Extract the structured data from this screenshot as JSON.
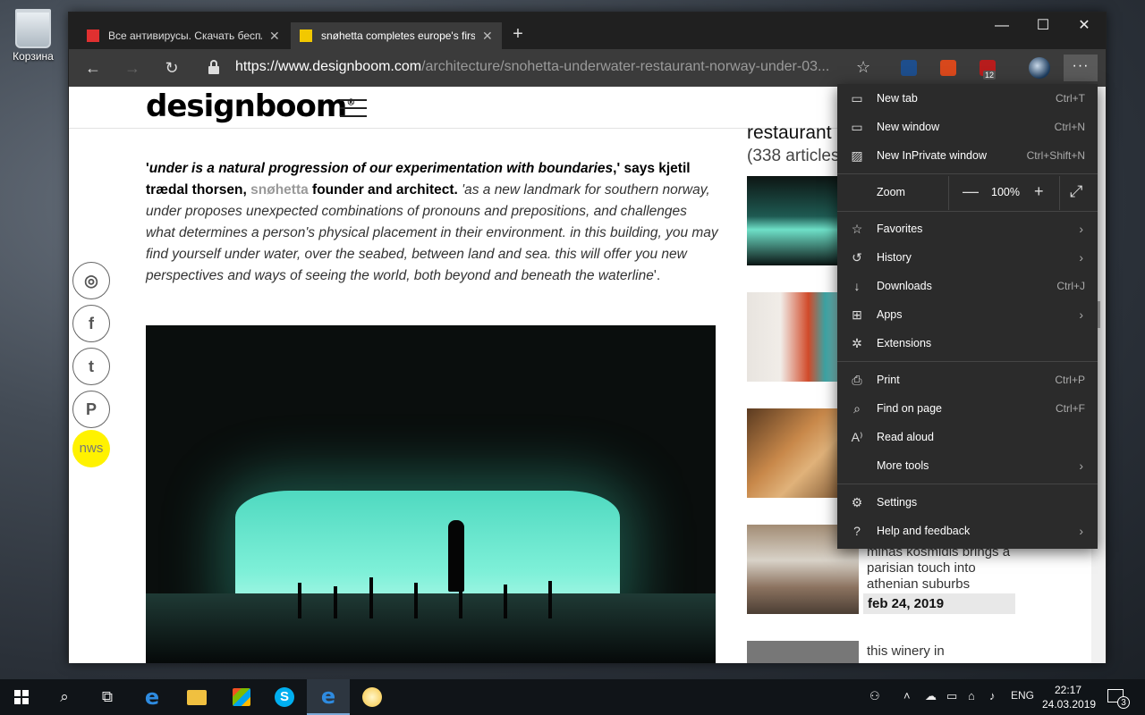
{
  "desktop": {
    "recycle_bin_label": "Корзина"
  },
  "browser": {
    "tabs": [
      {
        "title": "Все антивирусы. Скачать бесплатные"
      },
      {
        "title": "snøhetta completes europe's first"
      }
    ],
    "address": {
      "domain": "https://www.designboom.com",
      "path": "/architecture/snohetta-underwater-restaurant-norway-under-03..."
    },
    "extension_badge": "12",
    "more_button_label": "···"
  },
  "page": {
    "logo": "designboom",
    "logo_mark": "®",
    "quote": {
      "open": "'",
      "italic_bold": "under is a natural progression of our experimentation with boundaries",
      "after": ",' says kjetil trædal thorsen, ",
      "brand": "snøhetta",
      "role": " founder and architect. ",
      "body": "'as a new landmark for southern norway, under proposes unexpected combinations of pronouns and prepositions, and challenges what determines a person's physical placement in their environment. in this building, you may find yourself under water, over the seabed, between land and sea. this will offer you new perspectives and ways of seeing the world, both beyond and beneath the waterline",
      "close": "'."
    },
    "social": [
      "instagram-icon",
      "facebook-icon",
      "twitter-icon",
      "pinterest-icon"
    ],
    "nws_label": "nws",
    "sidebar": {
      "title": "restaurant",
      "count": "(338 articles",
      "cards": [
        {
          "text": "minas kosmidis brings a parisian touch into athenian suburbs",
          "date": "feb 24, 2019"
        },
        {
          "text": "this winery in"
        }
      ]
    }
  },
  "menu": {
    "items_top": [
      {
        "label": "New tab",
        "shortcut": "Ctrl+T",
        "icon": "new-tab-icon"
      },
      {
        "label": "New window",
        "shortcut": "Ctrl+N",
        "icon": "new-window-icon"
      },
      {
        "label": "New InPrivate window",
        "shortcut": "Ctrl+Shift+N",
        "icon": "inprivate-icon"
      }
    ],
    "zoom": {
      "label": "Zoom",
      "value": "100%",
      "minus": "—",
      "plus": "+"
    },
    "items_mid": [
      {
        "label": "Favorites",
        "icon": "star-icon",
        "submenu": true
      },
      {
        "label": "History",
        "icon": "history-icon",
        "submenu": true
      },
      {
        "label": "Downloads",
        "shortcut": "Ctrl+J",
        "icon": "download-icon"
      },
      {
        "label": "Apps",
        "icon": "apps-icon",
        "submenu": true
      },
      {
        "label": "Extensions",
        "icon": "extensions-icon"
      }
    ],
    "items_tools": [
      {
        "label": "Print",
        "shortcut": "Ctrl+P",
        "icon": "print-icon"
      },
      {
        "label": "Find on page",
        "shortcut": "Ctrl+F",
        "icon": "find-icon"
      },
      {
        "label": "Read aloud",
        "icon": "read-aloud-icon"
      },
      {
        "label": "More tools",
        "icon": "more-tools-icon",
        "submenu": true
      }
    ],
    "items_bottom": [
      {
        "label": "Settings",
        "icon": "gear-icon"
      },
      {
        "label": "Help and feedback",
        "icon": "help-icon",
        "submenu": true
      }
    ]
  },
  "taskbar": {
    "language": "ENG",
    "time": "22:17",
    "date": "24.03.2019",
    "notifications": "3"
  }
}
